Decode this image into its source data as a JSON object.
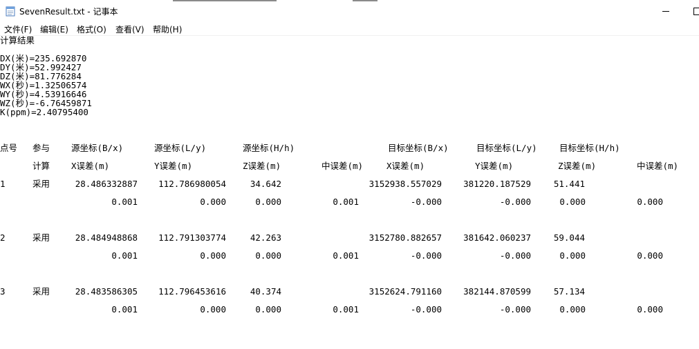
{
  "window": {
    "title": "SevenResult.txt - 记事本",
    "icon": "notepad-icon"
  },
  "menu": [
    "文件(F)",
    "编辑(E)",
    "格式(O)",
    "查看(V)",
    "帮助(H)"
  ],
  "doc": {
    "heading": "计算结果",
    "params": [
      "DX(米)=235.692870",
      "DY(米)=52.992427",
      "DZ(米)=81.776284",
      "WX(秒)=1.32506574",
      "WY(秒)=4.53916646",
      "WZ(秒)=-6.76459871",
      "K(ppm)=2.40795400"
    ],
    "header1": [
      "点号",
      "参与",
      "源坐标(B/x)",
      "源坐标(L/y)",
      "源坐标(H/h)",
      "目标坐标(B/x)",
      "目标坐标(L/y)",
      "目标坐标(H/h)"
    ],
    "header2": [
      "计算",
      "X误差(m)",
      "Y误差(m)",
      "Z误差(m)",
      "中误差(m)",
      "X误差(m)",
      "Y误差(m)",
      "Z误差(m)",
      "中误差(m)"
    ],
    "rows": [
      {
        "id": "1",
        "use": "采用",
        "src_b": "28.486332887",
        "src_l": "112.786980054",
        "src_h": "34.642",
        "dst_b": "3152938.557029",
        "dst_l": "381220.187529",
        "dst_h": "51.441",
        "err": [
          "0.001",
          "0.000",
          "0.000",
          "0.001",
          "-0.000",
          "-0.000",
          "0.000",
          "0.000"
        ]
      },
      {
        "id": "2",
        "use": "采用",
        "src_b": "28.484948868",
        "src_l": "112.791303774",
        "src_h": "42.263",
        "dst_b": "3152780.882657",
        "dst_l": "381642.060237",
        "dst_h": "59.044",
        "err": [
          "0.001",
          "0.000",
          "0.000",
          "0.001",
          "-0.000",
          "-0.000",
          "0.000",
          "0.000"
        ]
      },
      {
        "id": "3",
        "use": "采用",
        "src_b": "28.483586305",
        "src_l": "112.796453616",
        "src_h": "40.374",
        "dst_b": "3152624.791160",
        "dst_l": "382144.870599",
        "dst_h": "57.134",
        "err": [
          "0.001",
          "0.000",
          "0.000",
          "0.001",
          "-0.000",
          "-0.000",
          "0.000",
          "0.000"
        ]
      }
    ]
  }
}
